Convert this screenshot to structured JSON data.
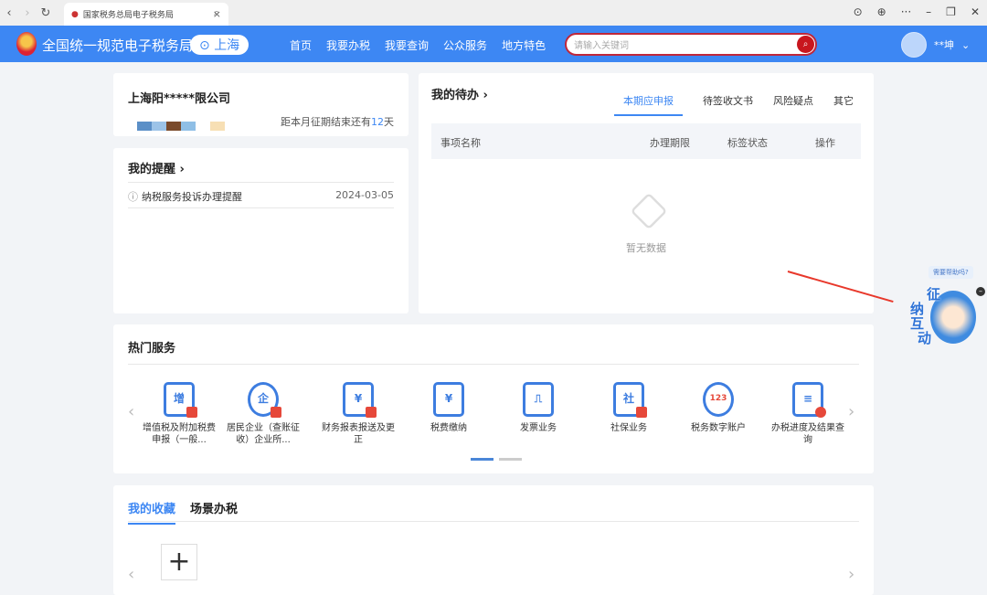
{
  "browser": {
    "tab_title": "国家税务总局电子税务局"
  },
  "header": {
    "site_title": "全国统一规范电子税务局",
    "city": "上海",
    "nav": [
      "首页",
      "我要办税",
      "我要查询",
      "公众服务",
      "地方特色"
    ],
    "search_placeholder": "请输入关键词",
    "user_name": "**坤"
  },
  "company": {
    "name": "上海阳*****限公司",
    "deadline_prefix": "距本月征期结束还有",
    "deadline_days": "12",
    "deadline_suffix": "天"
  },
  "reminders": {
    "title": "我的提醒 ›",
    "items": [
      {
        "text": "纳税服务投诉办理提醒",
        "date": "2024-03-05"
      }
    ]
  },
  "todo": {
    "title": "我的待办 ›",
    "tabs": [
      "本期应申报",
      "待签收文书",
      "风险疑点",
      "其它"
    ],
    "columns": [
      "事项名称",
      "办理期限",
      "标签状态",
      "操作"
    ],
    "empty": "暂无数据"
  },
  "hot": {
    "title": "热门服务",
    "items": [
      {
        "icon": "增",
        "label": "增值税及附加税费申报（一般..."
      },
      {
        "icon": "企",
        "label": "居民企业（查账征收）企业所..."
      },
      {
        "icon": "¥",
        "label": "财务报表报送及更正"
      },
      {
        "icon": "¥",
        "label": "税费缴纳"
      },
      {
        "icon": "⎍",
        "label": "发票业务"
      },
      {
        "icon": "社",
        "label": "社保业务"
      },
      {
        "icon": "123",
        "label": "税务数字账户"
      },
      {
        "icon": "≡",
        "label": "办税进度及结果查询"
      }
    ]
  },
  "favorites": {
    "tabs": [
      "我的收藏",
      "场景办税"
    ],
    "add": "+"
  },
  "assistant": {
    "bubble": "需要帮助吗?",
    "label": [
      "征",
      "纳",
      "互",
      "动"
    ]
  }
}
